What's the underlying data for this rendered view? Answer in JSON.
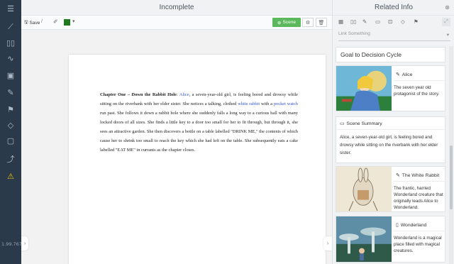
{
  "app": {
    "version": "1.99.767",
    "rail_icons": [
      "list-icon",
      "ruler-icon",
      "book-open-icon",
      "wave-icon",
      "notebook-icon",
      "pen-icon",
      "flag-icon",
      "gem-icon",
      "chat-icon",
      "chart-icon",
      "warning-icon"
    ]
  },
  "editor": {
    "title": "Incomplete",
    "toolbar": {
      "save_label": "Save",
      "separator": "/",
      "color": "#1f7a1f",
      "scene_label": "Scene"
    },
    "document": {
      "heading": "Chapter One – Down the Rabbit Hole",
      "t1": ": ",
      "l1": "Alice",
      "t2": ", a seven-year-old girl, is feeling bored and drowsy while sitting on the riverbank with her elder sister. She notices a talking, clothed ",
      "l2": "white rabbit",
      "t3": " with a ",
      "l3": "pocket watch",
      "t4": " run past. She follows it down a rabbit hole where she suddenly falls a long way to a curious hall with many locked doors of all sizes. She finds a little key to a door too small for her to fit through, but through it, she sees an attractive garden. She then discovers a bottle on a table labelled \"DRINK ME,\" the contents of which cause her to shrink too small to reach the key which she had left on the table. She subsequently eats a cake labelled \"EAT ME\" in currants as the chapter closes."
    }
  },
  "related": {
    "title": "Related Info",
    "link_placeholder": "Link Something",
    "section_title": "Goal to Decision Cycle",
    "cards": [
      {
        "name": "Alice",
        "text": "The seven year old protagonist of the story."
      },
      {
        "name": "The White Rabbit",
        "text": "The frantic, harried Wonderland creature that originally leads Alice to Wonderland."
      },
      {
        "name": "Wonderland",
        "text": "Wonderland is a magical place filled with magical creatures."
      }
    ],
    "summary": {
      "label": "Scene Summary",
      "text": "Alice, a seven-year-old girl, is feeling bored and drowsy while sitting on the riverbank with her elder sister."
    }
  }
}
